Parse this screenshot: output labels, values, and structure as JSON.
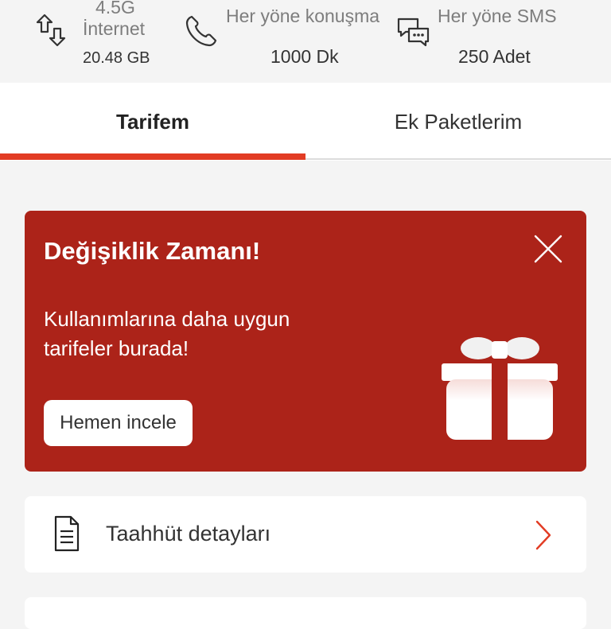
{
  "stats": {
    "internet": {
      "line1": "4.5G",
      "line2": "İnternet",
      "value": "20.48 GB",
      "icon": "data-transfer-icon"
    },
    "voice": {
      "label": "Her yöne konuşma",
      "value": "1000 Dk",
      "icon": "phone-icon"
    },
    "sms": {
      "label": "Her yöne SMS",
      "value": "250 Adet",
      "icon": "chat-bubbles-icon"
    }
  },
  "tabs": [
    {
      "label": "Tarifem",
      "active": true
    },
    {
      "label": "Ek Paketlerim",
      "active": false
    }
  ],
  "promo": {
    "title": "Değişiklik Zamanı!",
    "text": "Kullanımlarına daha uygun tarifeler burada!",
    "button": "Hemen incele",
    "icon": "gift-icon"
  },
  "menu": {
    "items": [
      {
        "label": "Taahhüt detayları",
        "icon": "document-icon"
      }
    ]
  },
  "colors": {
    "accent": "#e23c24",
    "promo_bg": "#ac2319",
    "page_bg": "#f4f4f4"
  }
}
